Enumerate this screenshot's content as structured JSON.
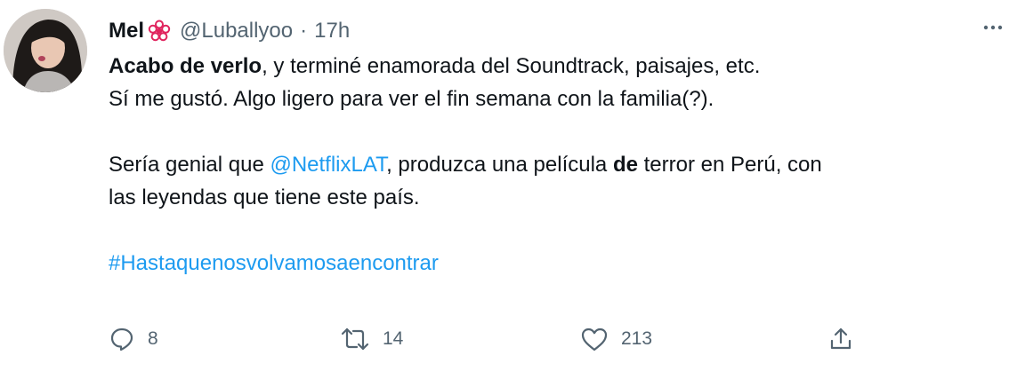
{
  "author": {
    "name": "Mel",
    "handle": "@Luballyoo",
    "separator": "·",
    "time": "17h"
  },
  "tweet": {
    "line1": {
      "bold": "Acabo de verlo",
      "rest": ", y terminé enamorada del Soundtrack, paisajes, etc."
    },
    "line2": "Sí me gustó. Algo ligero para ver el fin semana con la familia(?).",
    "line3": {
      "before": "Sería genial que ",
      "mention": "@NetflixLAT",
      "middle": ", produzca una película ",
      "bold": "de",
      "after": " terror en Perú, con"
    },
    "line4": "las leyendas que tiene este país.",
    "hashtag": "#Hastaquenosvolvamosaencontrar"
  },
  "actions": {
    "replies": "8",
    "retweets": "14",
    "likes": "213"
  },
  "colors": {
    "link": "#1d9bf0",
    "text": "#0f1419",
    "secondary": "#536471",
    "badge": "#e0245e"
  },
  "icons": [
    "avatar",
    "flower-badge-icon",
    "more-icon",
    "reply-icon",
    "retweet-icon",
    "like-icon",
    "share-icon"
  ]
}
